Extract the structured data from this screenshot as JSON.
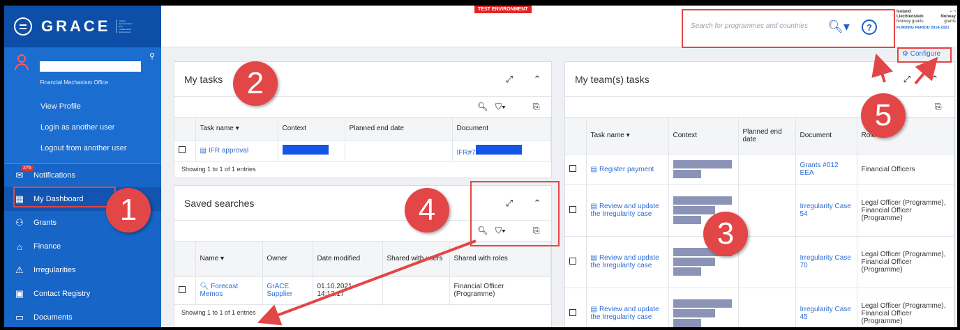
{
  "sidebar": {
    "logo": "GRACE",
    "logo_sub": "Grants Administration and Collaboration Environment",
    "user_org": "Financial Mechanism Office",
    "user_links": [
      "View Profile",
      "Login as another user",
      "Logout from another user"
    ],
    "nav": [
      {
        "label": "Notifications",
        "icon": "envelope-icon",
        "badge": "276"
      },
      {
        "label": "My Dashboard",
        "icon": "grid-icon"
      },
      {
        "label": "Grants",
        "icon": "grants-icon"
      },
      {
        "label": "Finance",
        "icon": "bank-icon"
      },
      {
        "label": "Irregularities",
        "icon": "warning-icon"
      },
      {
        "label": "Contact Registry",
        "icon": "contact-icon"
      },
      {
        "label": "Documents",
        "icon": "folder-icon"
      }
    ]
  },
  "topbar": {
    "env_label": "TEST ENVIRONMENT",
    "search_placeholder": "Search for programmes and countries",
    "help": "?",
    "funding": {
      "line1_left": "Iceland",
      "line2_left": "Liechtenstein",
      "line2_right": "Norway",
      "line3_left": "Norway grants",
      "line3_right": "grants",
      "period": "FUNDING PERIOD 2014-2021"
    },
    "configure": "Configure"
  },
  "my_tasks": {
    "title": "My tasks",
    "columns": [
      "Task name ▾",
      "Context",
      "Planned end date",
      "Document"
    ],
    "rows": [
      {
        "task": "IFR approval",
        "document": "IFR#7"
      }
    ],
    "footer": "Showing 1 to 1 of 1 entries"
  },
  "saved_searches": {
    "title": "Saved searches",
    "columns": [
      "Name ▾",
      "Owner",
      "Date modified",
      "Shared with users",
      "Shared with roles"
    ],
    "rows": [
      {
        "name": "Forecast Memos",
        "owner": "GrACE Supplier",
        "date": "01.10.2021 14:12:17",
        "shared_users": "",
        "shared_roles": "Financial Officer (Programme)"
      }
    ],
    "footer": "Showing 1 to 1 of 1 entries"
  },
  "team_tasks": {
    "title": "My team(s) tasks",
    "columns": [
      "Task name ▾",
      "Context",
      "Planned end date",
      "Document",
      "Role"
    ],
    "rows": [
      {
        "task": "Register payment",
        "document": "Grants #012 EEA",
        "role": "Financial Officers"
      },
      {
        "task": "Review and update the Irregularity case",
        "document": "Irregularity Case 54",
        "role": "Legal Officer (Programme), Financial Officer (Programme)"
      },
      {
        "task": "Review and update the Irregularity case",
        "document": "Irregularity Case 70",
        "role": "Legal Officer (Programme), Financial Officer (Programme)"
      },
      {
        "task": "Review and update the Irregularity case",
        "document": "Irregularity Case 45",
        "role": "Legal Officer (Programme), Financial Officer (Programme)"
      }
    ]
  },
  "annotations": [
    "1",
    "2",
    "3",
    "4",
    "5"
  ],
  "colors": {
    "sidebar": "#1665c7",
    "accent": "#2d6ed5",
    "annotation": "#e34646"
  }
}
